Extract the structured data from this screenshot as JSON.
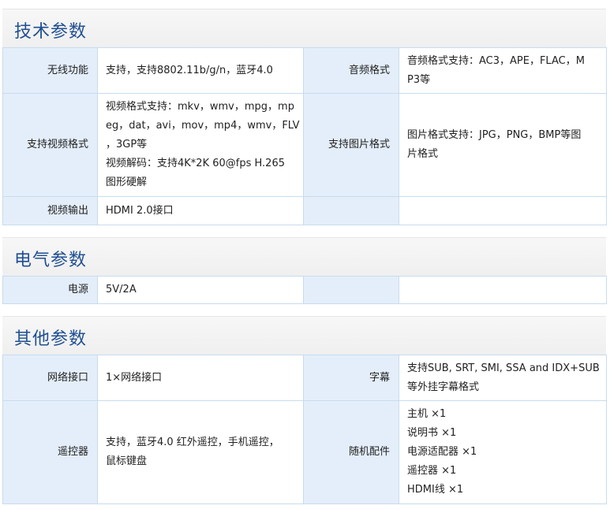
{
  "sections": [
    {
      "title": "技术参数",
      "rows": [
        {
          "label1": "无线功能",
          "value1": [
            "支持，支持8802.11b/g/n，蓝牙4.0"
          ],
          "label2": "音频格式",
          "value2": [
            "音频格式支持：AC3，APE，FLAC，M",
            "P3等"
          ]
        },
        {
          "label1": "支持视频格式",
          "value1": [
            "视频格式支持：mkv，wmv，mpg，mp",
            "eg，dat，avi，mov，mp4，wmv，FLV",
            "，3GP等",
            "视频解码：支持4K*2K 60@fps H.265",
            "图形硬解"
          ],
          "label2": "支持图片格式",
          "value2": [
            "图片格式支持：JPG，PNG，BMP等图",
            "片格式"
          ]
        },
        {
          "label1": "视频输出",
          "value1": [
            "HDMI 2.0接口"
          ],
          "label2": "",
          "value2": []
        }
      ]
    },
    {
      "title": "电气参数",
      "rows": [
        {
          "label1": "电源",
          "value1": [
            "5V/2A"
          ],
          "label2": "",
          "value2": []
        }
      ]
    },
    {
      "title": "其他参数",
      "rows": [
        {
          "label1": "网络接口",
          "value1": [
            "1×网络接口"
          ],
          "label2": "字幕",
          "value2": [
            "支持SUB, SRT, SMI, SSA and IDX+SUB",
            "等外挂字幕格式"
          ]
        },
        {
          "label1": "遥控器",
          "value1": [
            "支持，蓝牙4.0 红外遥控，手机遥控，",
            "鼠标键盘"
          ],
          "label2": "随机配件",
          "value2": [
            "主机 ×1",
            "说明书 ×1",
            "电源适配器 ×1",
            "遥控器 ×1",
            "HDMI线 ×1"
          ]
        }
      ]
    }
  ]
}
